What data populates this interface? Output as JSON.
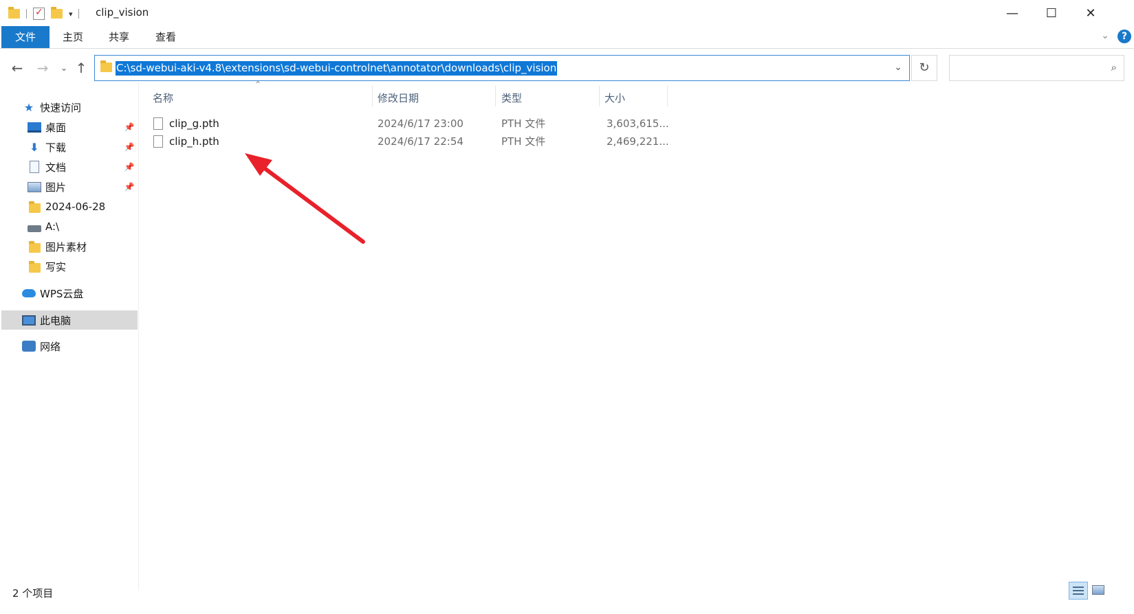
{
  "window": {
    "title": "clip_vision",
    "minimize": "—",
    "maximize": "☐",
    "close": "✕"
  },
  "ribbon": {
    "tabs": [
      "文件",
      "主页",
      "共享",
      "查看"
    ],
    "help": "?"
  },
  "address": {
    "path": "C:\\sd-webui-aki-v4.8\\extensions\\sd-webui-controlnet\\annotator\\downloads\\clip_vision",
    "search_placeholder": ""
  },
  "nav": {
    "quick_access": "快速访问",
    "items": [
      {
        "label": "桌面",
        "icon": "desktop-icon",
        "pinned": true
      },
      {
        "label": "下载",
        "icon": "download-icon",
        "pinned": true
      },
      {
        "label": "文档",
        "icon": "document-icon",
        "pinned": true
      },
      {
        "label": "图片",
        "icon": "pictures-icon",
        "pinned": true
      },
      {
        "label": "2024-06-28",
        "icon": "folder-icon",
        "pinned": false
      },
      {
        "label": "A:\\",
        "icon": "drive-icon",
        "pinned": false
      },
      {
        "label": "图片素材",
        "icon": "folder-icon",
        "pinned": false
      },
      {
        "label": "写实",
        "icon": "folder-icon",
        "pinned": false
      }
    ],
    "wps": "WPS云盘",
    "this_pc": "此电脑",
    "network": "网络"
  },
  "columns": {
    "name": "名称",
    "modified": "修改日期",
    "type": "类型",
    "size": "大小"
  },
  "files": [
    {
      "name": "clip_g.pth",
      "modified": "2024/6/17 23:00",
      "type": "PTH 文件",
      "size": "3,603,615..."
    },
    {
      "name": "clip_h.pth",
      "modified": "2024/6/17 22:54",
      "type": "PTH 文件",
      "size": "2,469,221..."
    }
  ],
  "status": {
    "item_count": "2 个项目"
  },
  "colors": {
    "accent": "#1979ca",
    "selection": "#0f78d7",
    "annotation_arrow": "#e8212a"
  }
}
